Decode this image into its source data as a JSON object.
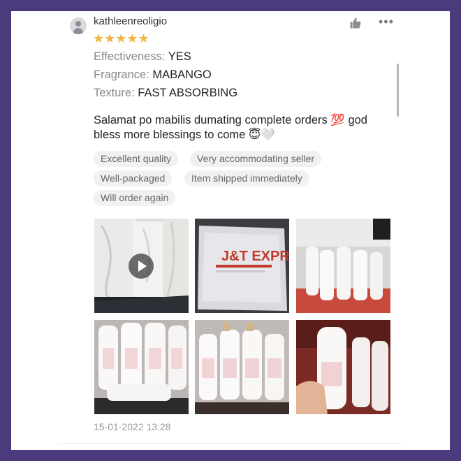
{
  "review": {
    "username": "kathleenreoligio",
    "avatar_icon": "user-avatar-icon",
    "rating": 5,
    "stars_text": "★★★★★",
    "star_color": "#f2b33a",
    "like_icon": "thumbs-up-icon",
    "more_label": "•••",
    "attributes": [
      {
        "label": "Effectiveness:",
        "value": "YES"
      },
      {
        "label": "Fragrance:",
        "value": "MABANGO"
      },
      {
        "label": "Texture:",
        "value": "FAST ABSORBING"
      }
    ],
    "comment": "Salamat po mabilis dumating complete orders 💯 god bless more blessings to come 😇🤍",
    "tags": [
      "Excellent quality",
      "Very accommodating seller",
      "Well-packaged",
      "Item shipped immediately",
      "Will order again"
    ],
    "photos": [
      {
        "kind": "video",
        "icon": "play-icon"
      },
      {
        "kind": "image",
        "overlay_text": "J&T EXPRESS"
      },
      {
        "kind": "image"
      },
      {
        "kind": "image"
      },
      {
        "kind": "image"
      },
      {
        "kind": "image"
      }
    ],
    "timestamp": "15-01-2022 13:28"
  }
}
